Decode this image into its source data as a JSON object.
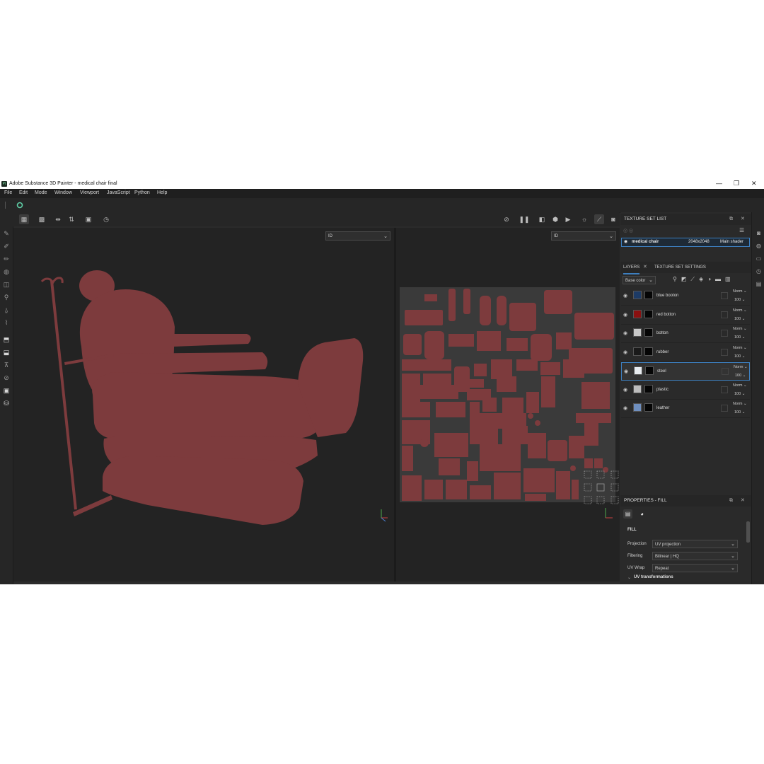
{
  "window": {
    "title": "Adobe Substance 3D Painter - medical chair final",
    "logo_text": "Pt",
    "minimize": "—",
    "restore": "❐",
    "close": "✕"
  },
  "menu": [
    "File",
    "Edit",
    "Mode",
    "Window",
    "Viewport",
    "JavaScript",
    "Python",
    "Help"
  ],
  "viewport3d": {
    "mode": "ID"
  },
  "viewport2d": {
    "mode": "ID"
  },
  "texture_set_list": {
    "title": "TEXTURE SET LIST",
    "item": {
      "name": "medical chair",
      "resolution": "2048x2048",
      "shader": "Main shader"
    }
  },
  "layers_panel": {
    "tabs": [
      "LAYERS",
      "TEXTURE SET SETTINGS"
    ],
    "channel": "Base color",
    "layers": [
      {
        "name": "blue booton",
        "blend": "Norm",
        "opacity": "100",
        "color": "#1d3b66",
        "selected": false
      },
      {
        "name": "red botton",
        "blend": "Norm",
        "opacity": "100",
        "color": "#8a1010",
        "selected": false
      },
      {
        "name": "botton",
        "blend": "Norm",
        "opacity": "100",
        "color": "#c8c8c8",
        "selected": false
      },
      {
        "name": "rubber",
        "blend": "Norm",
        "opacity": "100",
        "color": "#1a1a1a",
        "selected": false
      },
      {
        "name": "steel",
        "blend": "Norm",
        "opacity": "100",
        "color": "#e8ecf0",
        "selected": true
      },
      {
        "name": "plastic",
        "blend": "Norm",
        "opacity": "100",
        "color": "#bcbcbc",
        "selected": false
      },
      {
        "name": "leather",
        "blend": "Norm",
        "opacity": "100",
        "color": "#6f8fbf",
        "selected": false
      }
    ]
  },
  "properties": {
    "title": "PROPERTIES - FILL",
    "section": "FILL",
    "projection_label": "Projection",
    "projection_value": "UV projection",
    "filtering_label": "Filtering",
    "filtering_value": "Bilinear | HQ",
    "uvwrap_label": "UV Wrap",
    "uvwrap_value": "Repeat",
    "uv_transformations": "UV transformations"
  },
  "colors": {
    "id_fill": "#7d3b3d",
    "accent": "#3d7fbf"
  }
}
